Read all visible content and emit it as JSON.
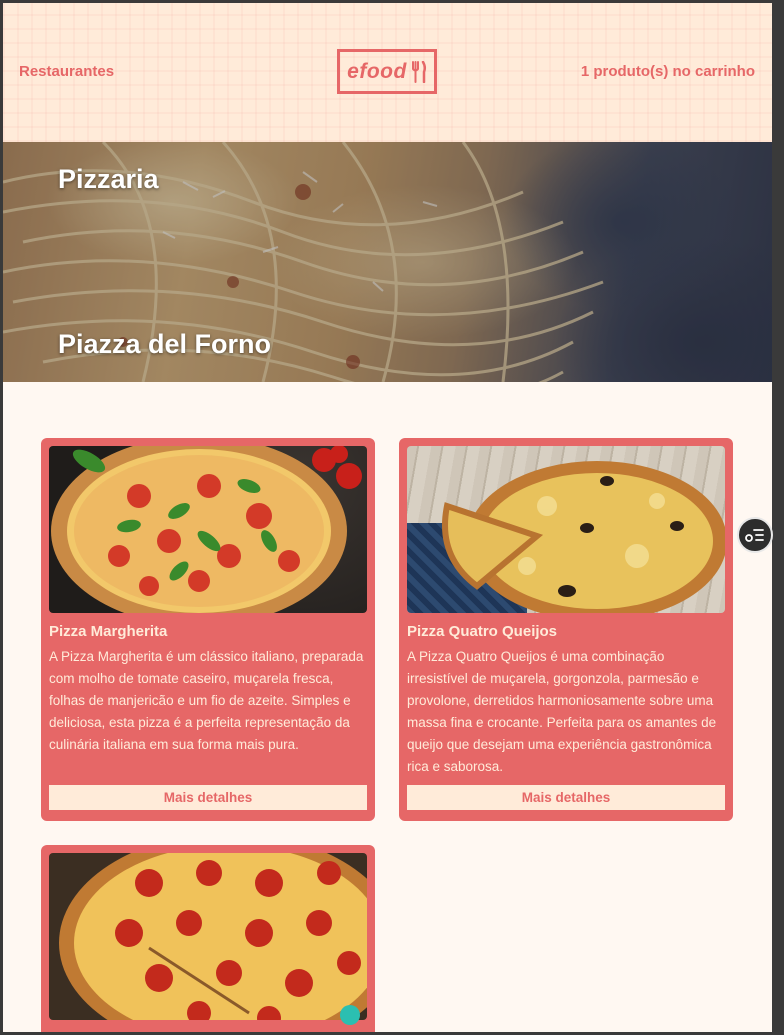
{
  "header": {
    "nav_restaurants": "Restaurantes",
    "logo_text": "efood",
    "cart_text": "1 produto(s) no carrinho"
  },
  "hero": {
    "type": "Pizzaria",
    "name": "Piazza del Forno"
  },
  "products": [
    {
      "title": "Pizza Margherita",
      "description": "A Pizza Margherita é um clássico italiano, preparada com molho de tomate caseiro, muçarela fresca, folhas de manjericão e um fio de azeite. Simples e deliciosa, esta pizza é a perfeita representação da culinária italiana em sua forma mais pura.",
      "button": "Mais detalhes"
    },
    {
      "title": "Pizza Quatro Queijos",
      "description": "A Pizza Quatro Queijos é uma combinação irresistível de muçarela, gorgonzola, parmesão e provolone, derretidos harmoniosamente sobre uma massa fina e crocante. Perfeita para os amantes de queijo que desejam uma experiência gastronômica rica e saborosa.",
      "button": "Mais detalhes"
    },
    {
      "title": "",
      "description": "",
      "button": ""
    }
  ],
  "colors": {
    "primary": "#e66767",
    "secondary": "#ffebd9",
    "background": "#fff8f2"
  },
  "icons": {
    "logo_cutlery": "fork-knife-icon",
    "side_button": "list-settings-icon"
  }
}
